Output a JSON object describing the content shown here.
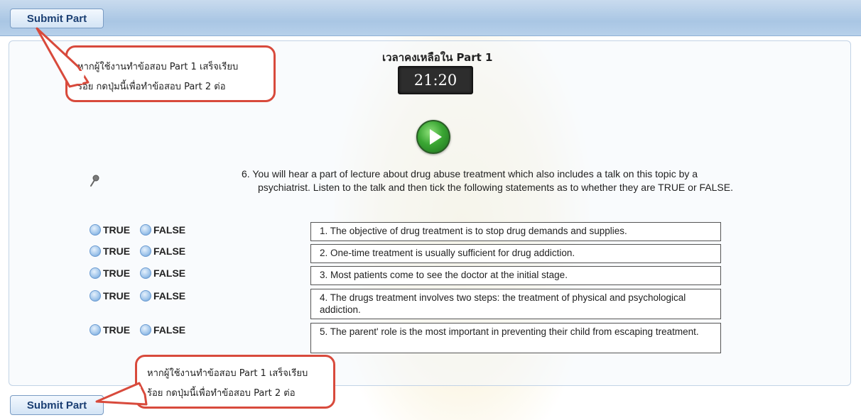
{
  "toolbar": {
    "submit_label": "Submit Part"
  },
  "callouts": [
    {
      "line1": "หากผู้ใช้งานทำข้อสอบ Part 1 เสร็จเรียบ",
      "line2": "ร้อย กดปุ่มนี้เพื่อทำข้อสอบ Part 2 ต่อ"
    },
    {
      "line1": "หากผู้ใช้งานทำข้อสอบ Part 1 เสร็จเรียบ",
      "line2": "ร้อย กดปุ่มนี้เพื่อทำข้อสอบ Part 2 ต่อ"
    }
  ],
  "timer": {
    "label": "เวลาคงเหลือใน Part 1",
    "value": "21:20"
  },
  "question": {
    "text": "6. You will hear a part of lecture about drug abuse treatment which also includes a talk on this topic by a psychiatrist. Listen to the talk and then tick the following statements as to whether they are TRUE or FALSE."
  },
  "options": {
    "true_label": "TRUE",
    "false_label": "FALSE"
  },
  "statements": [
    {
      "text": "1. The objective of drug treatment is to stop drug demands and supplies."
    },
    {
      "text": "2. One-time treatment is usually sufficient for drug addiction."
    },
    {
      "text": "3. Most patients come to see the doctor at the initial stage."
    },
    {
      "text": "4. The drugs treatment involves two steps: the treatment of physical and psychological addiction."
    },
    {
      "text": "5. The parent' role is the most important in preventing their child from escaping treatment."
    }
  ],
  "colors": {
    "header_bar": "#b7d0ea",
    "button_text": "#1b3f73",
    "callout_border": "#d84a3c",
    "timer_bg": "#2d2d2d",
    "play_green": "#3aa633",
    "radio_blue": "#6b9bd1"
  },
  "icons": {
    "play": "play-icon",
    "audio_pin": "pin-icon",
    "radio": "radio-icon"
  }
}
